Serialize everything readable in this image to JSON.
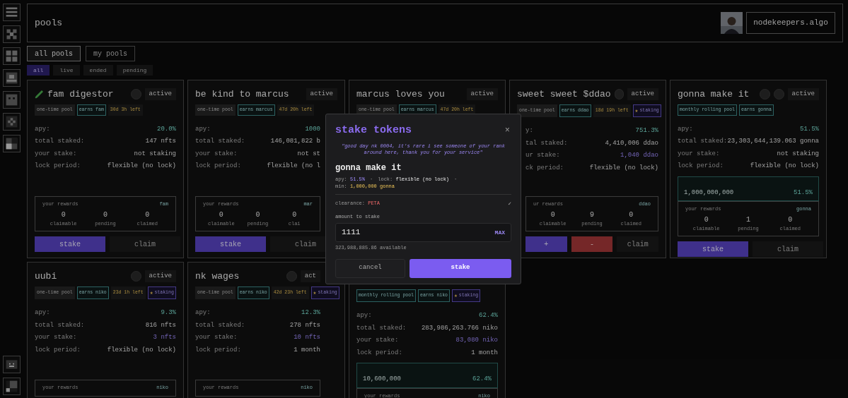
{
  "header": {
    "title": "pools",
    "account": "nodekeepers.algo"
  },
  "view_tabs": [
    {
      "label": "all pools",
      "selected": true
    },
    {
      "label": "my pools",
      "selected": false
    }
  ],
  "filters": [
    {
      "label": "all",
      "selected": true
    },
    {
      "label": "live",
      "selected": false
    },
    {
      "label": "ended",
      "selected": false
    },
    {
      "label": "pending",
      "selected": false
    }
  ],
  "pool_cards": [
    {
      "title": "fam digestor",
      "status": "active",
      "tags": [
        {
          "kind": "pool",
          "text": "one-time pool"
        },
        {
          "kind": "earns",
          "text": "earns fam"
        },
        {
          "kind": "time",
          "text": "30d 3h left"
        }
      ],
      "stats": [
        {
          "label": "apy:",
          "value": "20.0%",
          "kind": "accent"
        },
        {
          "label": "total staked:",
          "value": "147 nfts",
          "kind": "plain"
        },
        {
          "label": "your stake:",
          "value": "not staking",
          "kind": "plain"
        },
        {
          "label": "lock period:",
          "value": "flexible (no lock)",
          "kind": "plain"
        }
      ],
      "rewards": {
        "label": "your rewards",
        "token": "fam",
        "columns": [
          {
            "value": "0",
            "label": "claimable"
          },
          {
            "value": "0",
            "label": "pending"
          },
          {
            "value": "0",
            "label": "claimed"
          }
        ]
      },
      "buttons": [
        {
          "kind": "primary",
          "label": "stake"
        },
        {
          "kind": "ghost",
          "label": "claim"
        }
      ]
    },
    {
      "title": "be kind to marcus",
      "status": "active",
      "tags": [
        {
          "kind": "pool",
          "text": "one-time pool"
        },
        {
          "kind": "earns",
          "text": "earns marcus"
        },
        {
          "kind": "time",
          "text": "47d 20h left"
        }
      ],
      "stats": [
        {
          "label": "apy:",
          "value": "1000",
          "kind": "accent"
        },
        {
          "label": "total staked:",
          "value": "146,081,822 b",
          "kind": "plain"
        },
        {
          "label": "your stake:",
          "value": "not st",
          "kind": "plain"
        },
        {
          "label": "lock period:",
          "value": "flexible (no l",
          "kind": "plain"
        }
      ],
      "rewards": {
        "label": "your rewards",
        "token": "mar",
        "columns": [
          {
            "value": "0",
            "label": "claimable"
          },
          {
            "value": "0",
            "label": "pending"
          },
          {
            "value": "0",
            "label": "clai"
          }
        ]
      },
      "buttons": [
        {
          "kind": "primary",
          "label": "stake"
        },
        {
          "kind": "ghost",
          "label": "claim"
        }
      ]
    },
    {
      "title": "marcus loves you",
      "status": "active",
      "tags": [
        {
          "kind": "pool",
          "text": "one-time pool"
        },
        {
          "kind": "earns",
          "text": "earns marcus"
        },
        {
          "kind": "time",
          "text": "47d 20h left"
        }
      ]
    },
    {
      "title": "sweet sweet $ddao",
      "status": "active",
      "tags": [
        {
          "kind": "pool",
          "text": "one-time pool"
        },
        {
          "kind": "earns",
          "text": "earns ddao"
        },
        {
          "kind": "time",
          "text": "18d 19h left"
        },
        {
          "kind": "staking",
          "icon": "★",
          "text": "staking"
        }
      ],
      "stats": [
        {
          "label": "y:",
          "value": "751.3%",
          "kind": "accent"
        },
        {
          "label": "tal staked:",
          "value": "4,410,006 ddao",
          "kind": "plain"
        },
        {
          "label": "ur stake:",
          "value": "1,040 ddao",
          "kind": "stake"
        },
        {
          "label": "ck period:",
          "value": "flexible (no lock)",
          "kind": "plain"
        }
      ],
      "rewards": {
        "label": "ur rewards",
        "token": "ddao",
        "columns": [
          {
            "value": "0",
            "label": "claimable"
          },
          {
            "value": "9",
            "label": "pending"
          },
          {
            "value": "0",
            "label": "claimed"
          }
        ]
      },
      "buttons": [
        {
          "kind": "primary",
          "label": "+"
        },
        {
          "kind": "danger",
          "label": "-"
        },
        {
          "kind": "ghost",
          "label": "claim"
        }
      ]
    },
    {
      "title": "gonna make it",
      "status": "active",
      "tags": [
        {
          "kind": "earns",
          "text": "monthly rolling pool"
        },
        {
          "kind": "earns",
          "text": "earns gonna"
        }
      ],
      "stats": [
        {
          "label": "apy:",
          "value": "51.5%",
          "kind": "accent"
        },
        {
          "label": "total staked:",
          "value": "23,303,644,139.063 gonna",
          "kind": "plain"
        },
        {
          "label": "your stake:",
          "value": "not staking",
          "kind": "plain"
        },
        {
          "label": "lock period:",
          "value": "flexible (no lock)",
          "kind": "plain"
        }
      ],
      "tiers": [
        {
          "amount": "1,000,000,000",
          "apy": "51.5%"
        }
      ],
      "rewards": {
        "label": "your rewards",
        "token": "gonna",
        "columns": [
          {
            "value": "0",
            "label": "claimable"
          },
          {
            "value": "1",
            "label": "pending"
          },
          {
            "value": "0",
            "label": "claimed"
          }
        ]
      },
      "buttons": [
        {
          "kind": "primary",
          "label": "stake"
        },
        {
          "kind": "ghost",
          "label": "claim"
        }
      ]
    },
    {
      "title": "uubi",
      "status": "active",
      "tags": [
        {
          "kind": "pool",
          "text": "one-time pool"
        },
        {
          "kind": "earns",
          "text": "earns niko"
        },
        {
          "kind": "time",
          "text": "23d 1h left"
        },
        {
          "kind": "staking",
          "icon": "★",
          "text": "staking"
        }
      ],
      "stats": [
        {
          "label": "apy:",
          "value": "9.3%",
          "kind": "accent"
        },
        {
          "label": "total staked:",
          "value": "816 nfts",
          "kind": "plain"
        },
        {
          "label": "your stake:",
          "value": "3 nfts",
          "kind": "stake"
        },
        {
          "label": "lock period:",
          "value": "flexible (no lock)",
          "kind": "plain"
        }
      ],
      "rewards": {
        "label": "your rewards",
        "token": "niko"
      }
    },
    {
      "title": "nk wages",
      "status": "act",
      "tags": [
        {
          "kind": "pool",
          "text": "one-time pool"
        },
        {
          "kind": "earns",
          "text": "earns niko"
        },
        {
          "kind": "time",
          "text": "42d 23h left"
        },
        {
          "kind": "staking",
          "icon": "★",
          "text": "staking"
        }
      ],
      "stats": [
        {
          "label": "apy:",
          "value": "12.3%",
          "kind": "accent"
        },
        {
          "label": "total staked:",
          "value": "278 nfts",
          "kind": "plain"
        },
        {
          "label": "your stake:",
          "value": "10 nfts",
          "kind": "stake"
        },
        {
          "label": "lock period:",
          "value": "1 month",
          "kind": "plain"
        }
      ],
      "rewards": {
        "label": "your rewards",
        "token": "niko"
      }
    },
    {
      "tags": [
        {
          "kind": "earns",
          "text": "monthly rolling pool"
        },
        {
          "kind": "earns",
          "text": "earns niko"
        },
        {
          "kind": "staking",
          "icon": "★",
          "text": "staking"
        }
      ],
      "stats": [
        {
          "label": "apy:",
          "value": "62.4%",
          "kind": "accent"
        },
        {
          "label": "total staked:",
          "value": "283,986,263.766 niko",
          "kind": "plain"
        },
        {
          "label": "your stake:",
          "value": "83,080 niko",
          "kind": "stake"
        },
        {
          "label": "lock period:",
          "value": "1 month",
          "kind": "plain"
        }
      ],
      "tiers": [
        {
          "amount": "10,600,000",
          "apy": "62.4%"
        }
      ],
      "rewards": {
        "label": "your rewards",
        "token": "niko"
      }
    }
  ],
  "modal": {
    "title": "stake tokens",
    "close": "×",
    "quote": "\"good day nk 0004, it's rare i see someone of your rank around here, thank you for your service\"",
    "pool": "gonna make it",
    "terms": [
      {
        "label": "apy:",
        "value": "51.5%",
        "kind": "stake"
      },
      {
        "label": "lock:",
        "value": "flexible (no lock)",
        "kind": "plain"
      }
    ],
    "separator": "·",
    "min": {
      "label": "min:",
      "value": "1,000,000 gonna"
    },
    "clearance": {
      "label": "clearance:",
      "value": "PETA",
      "check": "✓"
    },
    "amount_label": "amount to stake",
    "amount": "1111",
    "max": "MAX",
    "available": "323,988,885.86 available",
    "buttons": [
      {
        "kind": "ghost",
        "label": "cancel"
      },
      {
        "kind": "primary",
        "label": "stake"
      }
    ]
  }
}
